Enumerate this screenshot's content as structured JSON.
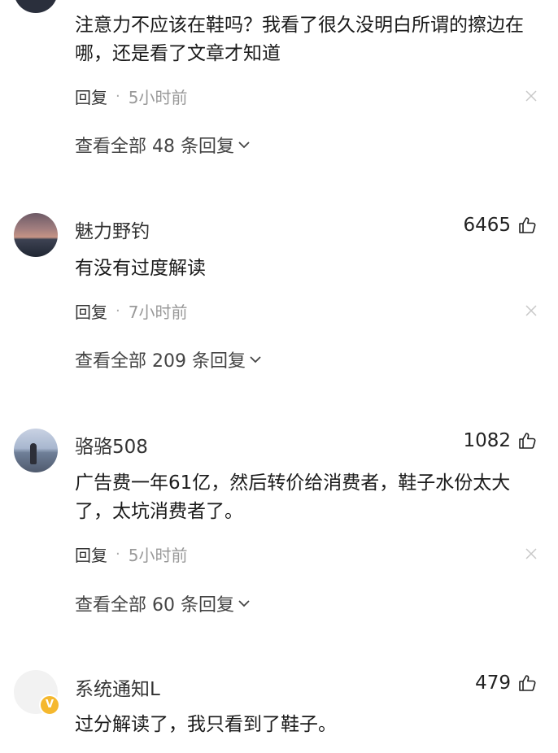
{
  "comments": [
    {
      "content": "注意力不应该在鞋吗？我看了很久没明白所谓的擦边在哪，还是看了文章才知道",
      "reply_label": "回复",
      "time": "5小时前",
      "view_all": "查看全部 48 条回复"
    },
    {
      "username": "魅力野钓",
      "likes": "6465",
      "content": "有没有过度解读",
      "reply_label": "回复",
      "time": "7小时前",
      "view_all": "查看全部 209 条回复"
    },
    {
      "username": "骆骆508",
      "likes": "1082",
      "content": "广告费一年61亿，然后转价给消费者，鞋子水份太大了，太坑消费者了。",
      "reply_label": "回复",
      "time": "5小时前",
      "view_all": "查看全部 60 条回复"
    },
    {
      "username": "系统通知L",
      "likes": "479",
      "content": "过分解读了，我只看到了鞋子。",
      "badge": "V"
    }
  ],
  "icons": {
    "like": "thumbs-up-icon",
    "close": "close-icon",
    "expand": "chevron-down-icon"
  },
  "colors": {
    "badge": "#f5b82e",
    "muted": "#999999"
  }
}
